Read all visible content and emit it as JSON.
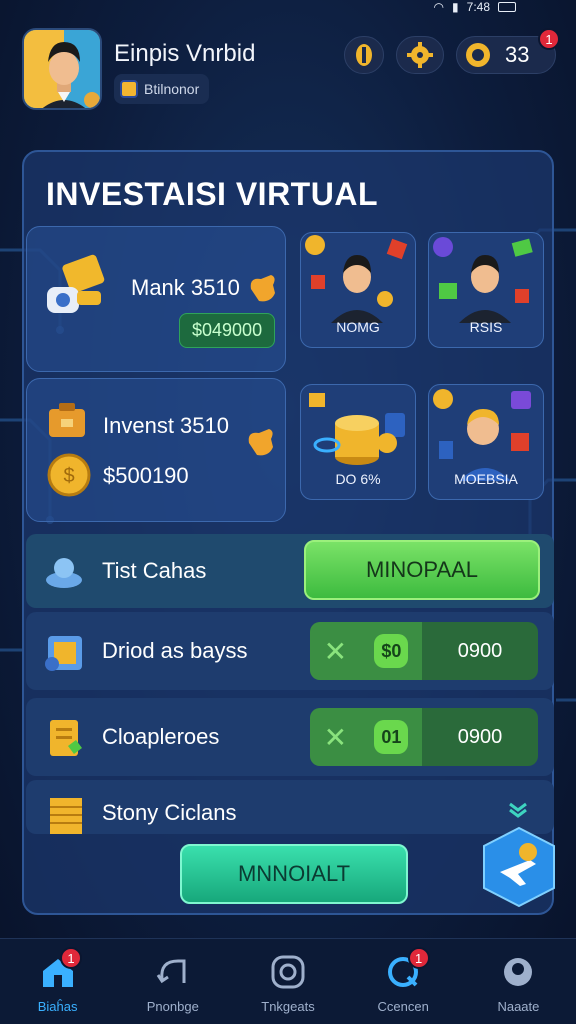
{
  "status_bar": {
    "time": "7:48"
  },
  "player": {
    "name": "Einpis Vnrbid",
    "subtitle": "Btilnonor"
  },
  "header": {
    "coin_count": "33",
    "notification_count": "1"
  },
  "panel": {
    "title": "INVESTAISI VIRTUAL",
    "card_1": {
      "label": "Mank 3510",
      "price": "$049000"
    },
    "card_2": {
      "label": "Invenst 3510",
      "value": "$500190"
    },
    "tiles": [
      {
        "label": "NOMG"
      },
      {
        "label": "RSIS"
      },
      {
        "label": "DO 6%"
      },
      {
        "label": "MOEBSIA"
      }
    ]
  },
  "rows": [
    {
      "title": "Tist Cahas",
      "button": "MINOPAAL"
    },
    {
      "title": "Driod as bayss",
      "value": "0900",
      "badge": "$0"
    },
    {
      "title": "Cloaplerоes",
      "value": "0900",
      "badge": "01"
    },
    {
      "title": "Stony Ciclans"
    }
  ],
  "cta_label": "MNNOIALT",
  "nav": {
    "items": [
      {
        "label": "Biaĥas",
        "badge": "1"
      },
      {
        "label": "Pnonbge"
      },
      {
        "label": "Tnkgeats"
      },
      {
        "label": "Ccencen",
        "badge": "1"
      },
      {
        "label": "Naaate"
      }
    ]
  },
  "colors": {
    "background": "#0b1630",
    "panel": "#1c386e",
    "accent_green": "#4fc944",
    "accent_teal": "#1fc592",
    "nav_active": "#3ab0ff"
  }
}
